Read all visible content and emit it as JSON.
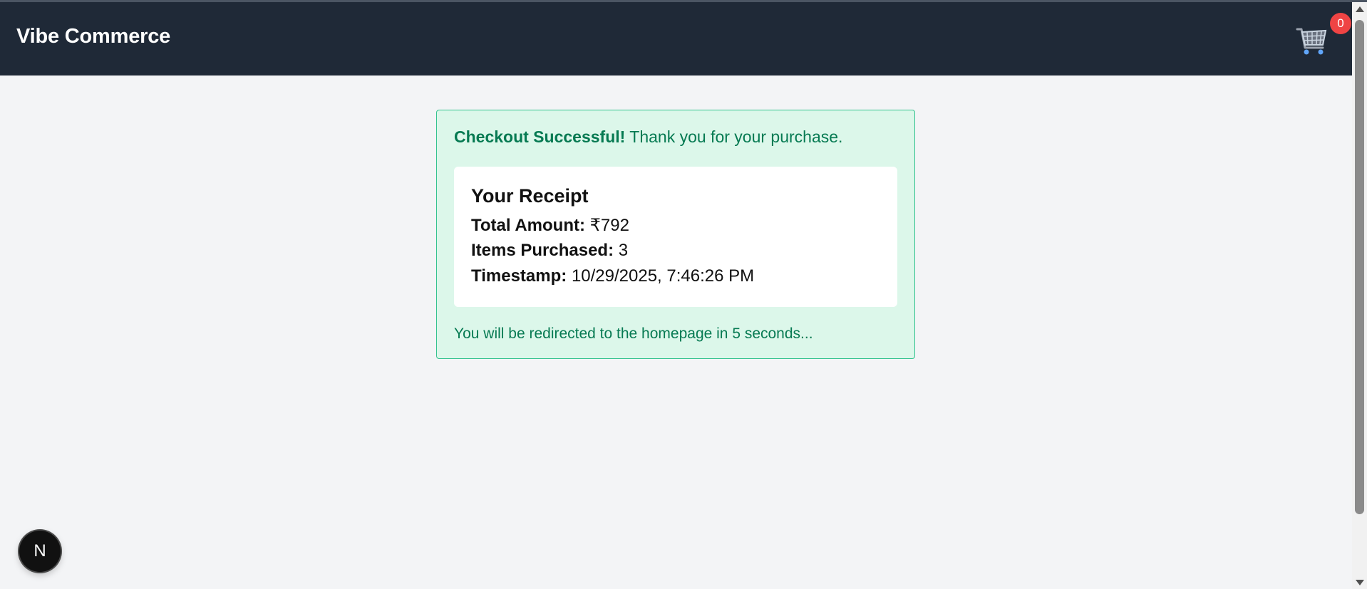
{
  "header": {
    "brand": "Vibe Commerce",
    "cart_icon": "shopping-cart-icon",
    "cart_count": "0"
  },
  "alert": {
    "headline": "Checkout Successful!",
    "message": " Thank you for your purchase.",
    "redirect_text": "You will be redirected to the homepage in 5 seconds..."
  },
  "receipt": {
    "title": "Your Receipt",
    "total_label": "Total Amount:",
    "total_value": "₹792",
    "items_label": "Items Purchased:",
    "items_value": "3",
    "timestamp_label": "Timestamp:",
    "timestamp_value": "10/29/2025, 7:46:26 PM"
  },
  "devtools": {
    "badge_letter": "N",
    "icon": "nextjs-logo-icon"
  },
  "colors": {
    "navbar": "#1f2937",
    "page_background": "#f3f4f6",
    "alert_background": "#dcf7ea",
    "alert_border": "#34c38f",
    "alert_text": "#067a52",
    "badge": "#ef4444"
  }
}
